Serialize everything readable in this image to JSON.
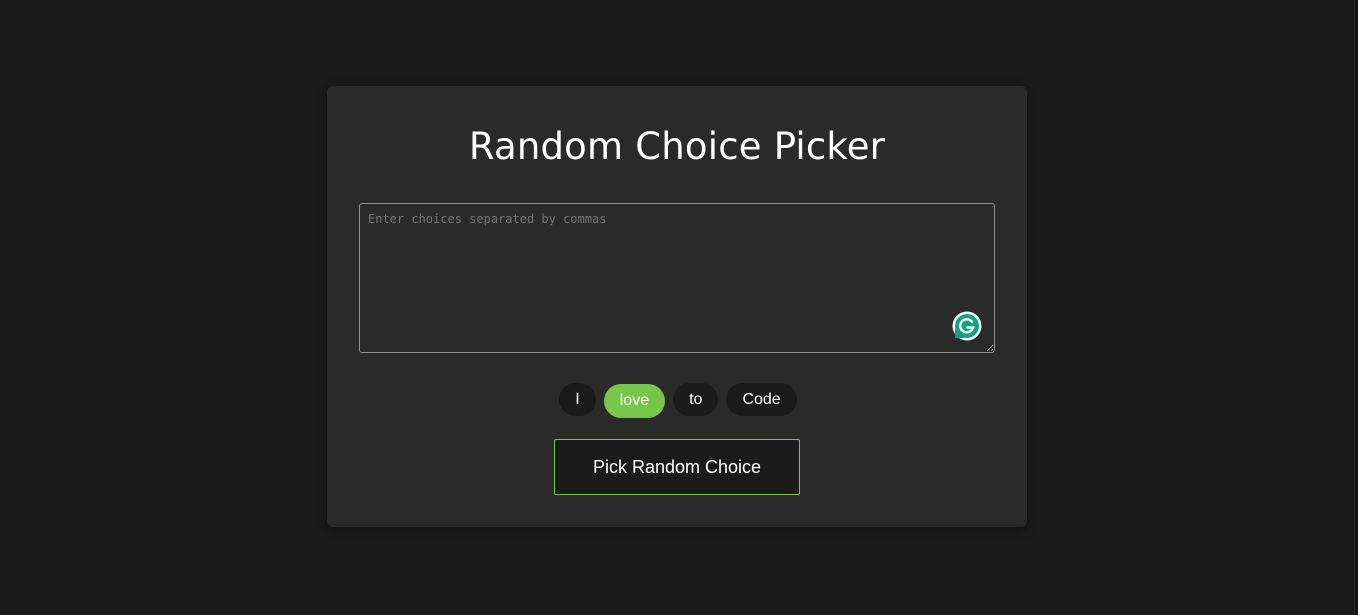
{
  "app": {
    "title": "Random Choice Picker"
  },
  "input": {
    "placeholder": "Enter choices separated by commas",
    "value": ""
  },
  "tags": [
    {
      "label": "I",
      "highlighted": false
    },
    {
      "label": "love",
      "highlighted": true
    },
    {
      "label": "to",
      "highlighted": false
    },
    {
      "label": "Code",
      "highlighted": false
    }
  ],
  "button": {
    "label": "Pick Random Choice"
  },
  "colors": {
    "background": "#1b1b1b",
    "card": "#2a2a2a",
    "accent": "#77c64a",
    "grammarly": "#15a181"
  },
  "icons": {
    "textarea_extension": "grammarly-icon"
  }
}
